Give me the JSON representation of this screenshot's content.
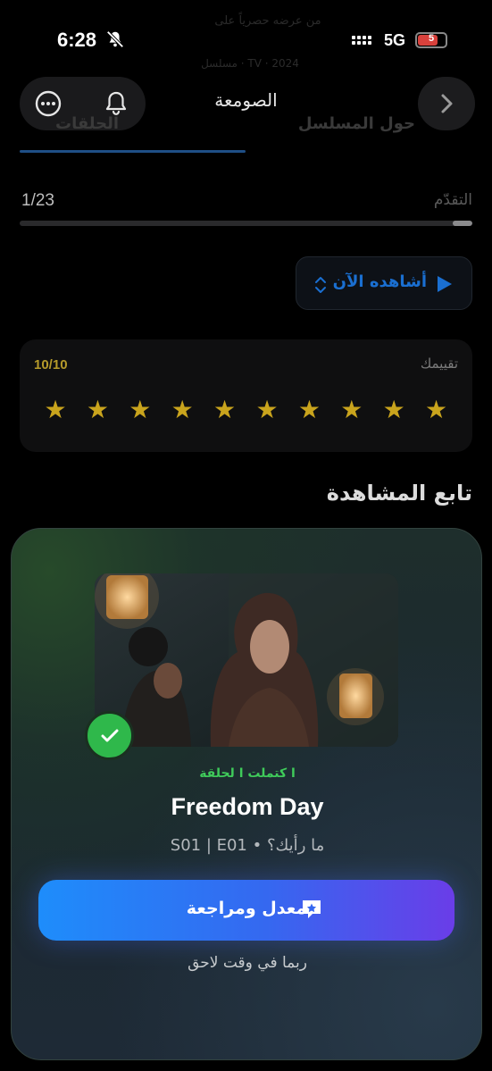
{
  "status_bar": {
    "time": "6:28",
    "network": "5G",
    "battery": "5",
    "ghost_top": "ﻣﻦ ﻋﺮﺿﻪ ﺣﺼﺮﻳﺎً ﻋﻠﻰ",
    "ghost_sub": "ﻣﺴﻠﺴﻞ  ·  TV  ·  2024"
  },
  "header": {
    "title": "الصومعة"
  },
  "tabs": [
    {
      "label": "الحلقات",
      "active": true
    },
    {
      "label": "حول المسلسل",
      "active": false
    }
  ],
  "progress": {
    "label": "التقدّم",
    "count": "1/23",
    "fraction": 0.0435
  },
  "watch": {
    "label": "أشاهده الآن"
  },
  "rating": {
    "label": "تقييمك",
    "value": "10/10",
    "stars": 10
  },
  "continue": {
    "heading": "تابع المشاهدة"
  },
  "episode": {
    "tag": "ا كتملت ا لحلقة",
    "title": "Freedom Day",
    "meta": "S01 | E01  •  ما رأيك؟",
    "rate_button": "معدل ومراجعة",
    "later": "ربما في وقت لاحق"
  },
  "colors": {
    "accent": "#1a6fd1",
    "star": "#c9a41d",
    "success": "#2fb84b"
  }
}
